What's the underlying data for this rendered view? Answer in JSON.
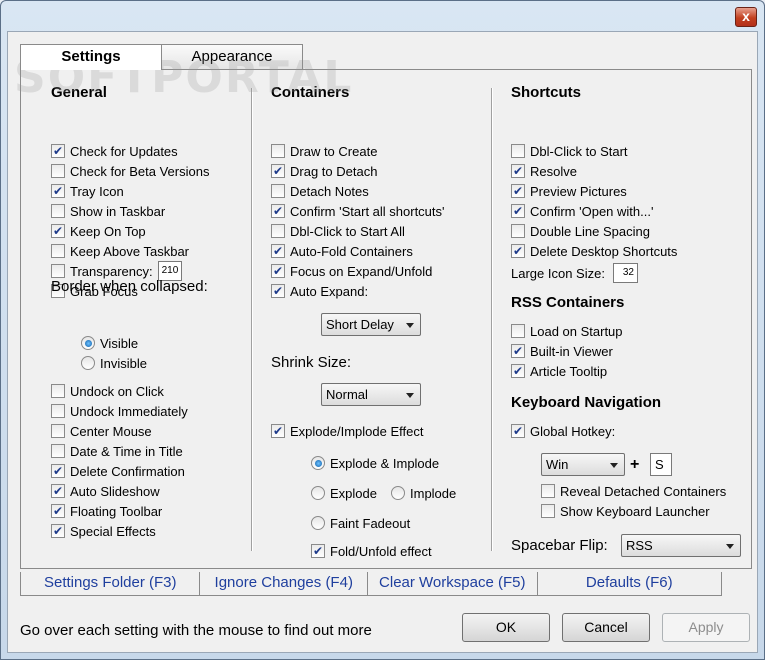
{
  "window": {
    "close_glyph": "x"
  },
  "tabs": [
    {
      "label": "Settings",
      "active": true
    },
    {
      "label": "Appearance",
      "active": false
    }
  ],
  "general": {
    "heading": "General",
    "items": [
      {
        "label": "Check for Updates",
        "checked": true
      },
      {
        "label": "Check for Beta Versions",
        "checked": false
      },
      {
        "label": "Tray Icon",
        "checked": true
      },
      {
        "label": "Show in Taskbar",
        "checked": false
      },
      {
        "label": "Keep On Top",
        "checked": true
      },
      {
        "label": "Keep Above Taskbar",
        "checked": false
      },
      {
        "label": "Transparency:",
        "checked": false
      },
      {
        "label": "Grab Focus",
        "checked": false
      }
    ],
    "transparency_value": "210",
    "border_label": "Border when collapsed:",
    "border_options": [
      {
        "label": "Visible",
        "selected": true
      },
      {
        "label": "Invisible",
        "selected": false
      }
    ],
    "items2": [
      {
        "label": "Undock on Click",
        "checked": false
      },
      {
        "label": "Undock Immediately",
        "checked": false
      },
      {
        "label": "Center Mouse",
        "checked": false
      },
      {
        "label": "Date & Time in Title",
        "checked": false
      },
      {
        "label": "Delete Confirmation",
        "checked": true
      },
      {
        "label": "Auto Slideshow",
        "checked": true
      },
      {
        "label": "Floating Toolbar",
        "checked": true
      },
      {
        "label": "Special Effects",
        "checked": true
      }
    ]
  },
  "containers": {
    "heading": "Containers",
    "items": [
      {
        "label": "Draw to Create",
        "checked": false
      },
      {
        "label": "Drag to Detach",
        "checked": true
      },
      {
        "label": "Detach Notes",
        "checked": false
      },
      {
        "label": "Confirm 'Start all shortcuts'",
        "checked": true
      },
      {
        "label": "Dbl-Click to Start All",
        "checked": false
      },
      {
        "label": "Auto-Fold Containers",
        "checked": true
      },
      {
        "label": "Focus on Expand/Unfold",
        "checked": true
      },
      {
        "label": "Auto Expand:",
        "checked": true
      }
    ],
    "expand_delay": "Short Delay",
    "shrink_label": "Shrink Size:",
    "shrink_value": "Normal",
    "explode_label": "Explode/Implode Effect",
    "explode_checked": true,
    "effects": [
      {
        "label": "Explode & Implode",
        "selected": true
      },
      {
        "label": "Explode",
        "selected": false
      },
      {
        "label": "Implode",
        "selected": false
      },
      {
        "label": "Faint Fadeout",
        "selected": false
      }
    ],
    "fold_label": "Fold/Unfold effect",
    "fold_checked": true
  },
  "shortcuts": {
    "heading": "Shortcuts",
    "items": [
      {
        "label": "Dbl-Click to Start",
        "checked": false
      },
      {
        "label": "Resolve",
        "checked": true
      },
      {
        "label": "Preview Pictures",
        "checked": true
      },
      {
        "label": "Confirm 'Open with...'",
        "checked": true
      },
      {
        "label": "Double Line Spacing",
        "checked": false
      },
      {
        "label": "Delete Desktop Shortcuts",
        "checked": true
      }
    ],
    "icon_size_label": "Large Icon Size:",
    "icon_size_value": "32"
  },
  "rss": {
    "heading": "RSS Containers",
    "items": [
      {
        "label": "Load on Startup",
        "checked": false
      },
      {
        "label": "Built-in Viewer",
        "checked": true
      },
      {
        "label": "Article Tooltip",
        "checked": true
      }
    ]
  },
  "keyboard": {
    "heading": "Keyboard Navigation",
    "hotkey_label": "Global Hotkey:",
    "hotkey_checked": true,
    "modifier": "Win",
    "plus": "+",
    "key": "S",
    "items": [
      {
        "label": "Reveal Detached Containers",
        "checked": false
      },
      {
        "label": "Show Keyboard Launcher",
        "checked": false
      }
    ],
    "spacebar_label": "Spacebar Flip:",
    "spacebar_value": "RSS"
  },
  "bottom_tabs": [
    "Settings Folder (F3)",
    "Ignore Changes (F4)",
    "Clear Workspace (F5)",
    "Defaults (F6)"
  ],
  "hint": "Go over each setting with the mouse to find out more",
  "buttons": {
    "ok": "OK",
    "cancel": "Cancel",
    "apply": "Apply"
  },
  "watermark": "SOFTPORTAL"
}
